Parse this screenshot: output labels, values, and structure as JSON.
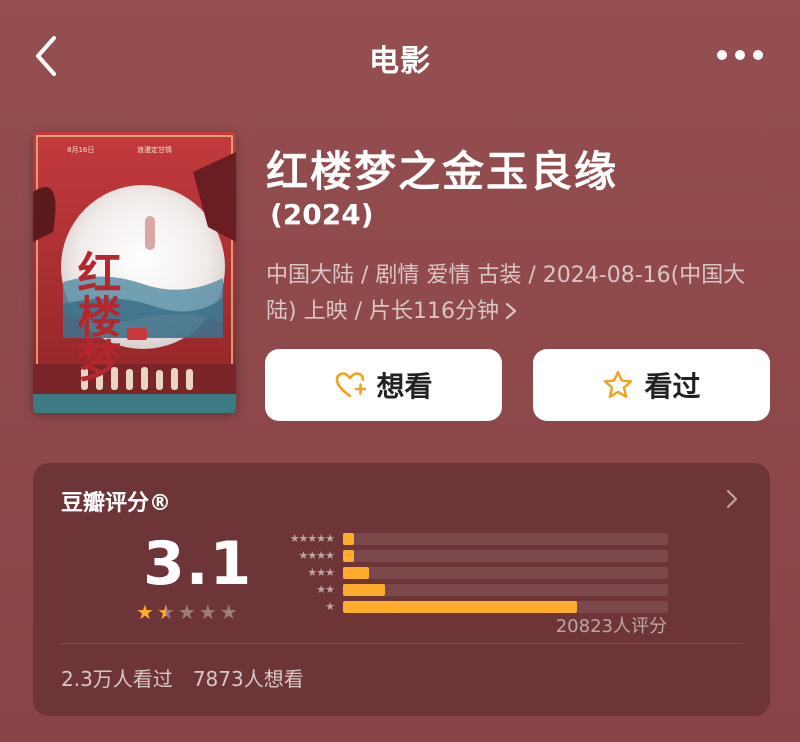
{
  "header": {
    "title": "电影",
    "back_icon": "chevron-left-icon",
    "more_icon": "more-dots-icon"
  },
  "movie": {
    "title": "红楼梦之金玉良缘",
    "year": "(2024)",
    "meta": "中国大陆 / 剧情 爱情 古装 / 2024-08-16(中国大陆) 上映 / 片长116分钟",
    "poster_text": {
      "main": "红楼梦",
      "top_left": "8月16日",
      "top_right": "浪漫定甘情"
    }
  },
  "actions": {
    "want_label": "想看",
    "seen_label": "看过"
  },
  "rating": {
    "source": "豆瓣评分®",
    "score": "3.1",
    "stars_value": 1.5,
    "count_text": "20823人评分",
    "distribution": [
      {
        "stars": 5,
        "fraction": 0.035
      },
      {
        "stars": 4,
        "fraction": 0.035
      },
      {
        "stars": 3,
        "fraction": 0.08
      },
      {
        "stars": 2,
        "fraction": 0.13
      },
      {
        "stars": 1,
        "fraction": 0.72
      }
    ],
    "seen_stat": "2.3万人看过",
    "want_stat": "7873人想看"
  },
  "colors": {
    "background": "#8e4a4c",
    "card": "#6d3537",
    "accent": "#ffac2d"
  }
}
